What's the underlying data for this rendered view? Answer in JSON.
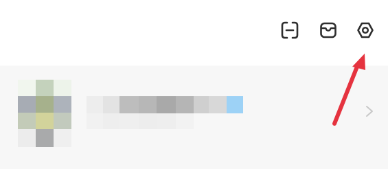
{
  "header": {
    "icons": [
      "scan-icon",
      "box-icon",
      "settings-icon"
    ]
  },
  "profile": {
    "avatar": "pixelated-avatar",
    "name": "",
    "chevron": "chevron-right-icon"
  },
  "colors": {
    "icon": "#2e2e2e",
    "arrow": "#e5333f",
    "chevron": "#c8c8c8",
    "background": "#ffffff",
    "profile_background": "#f7f7f7",
    "highlight_blue": "#9dd2f6"
  }
}
